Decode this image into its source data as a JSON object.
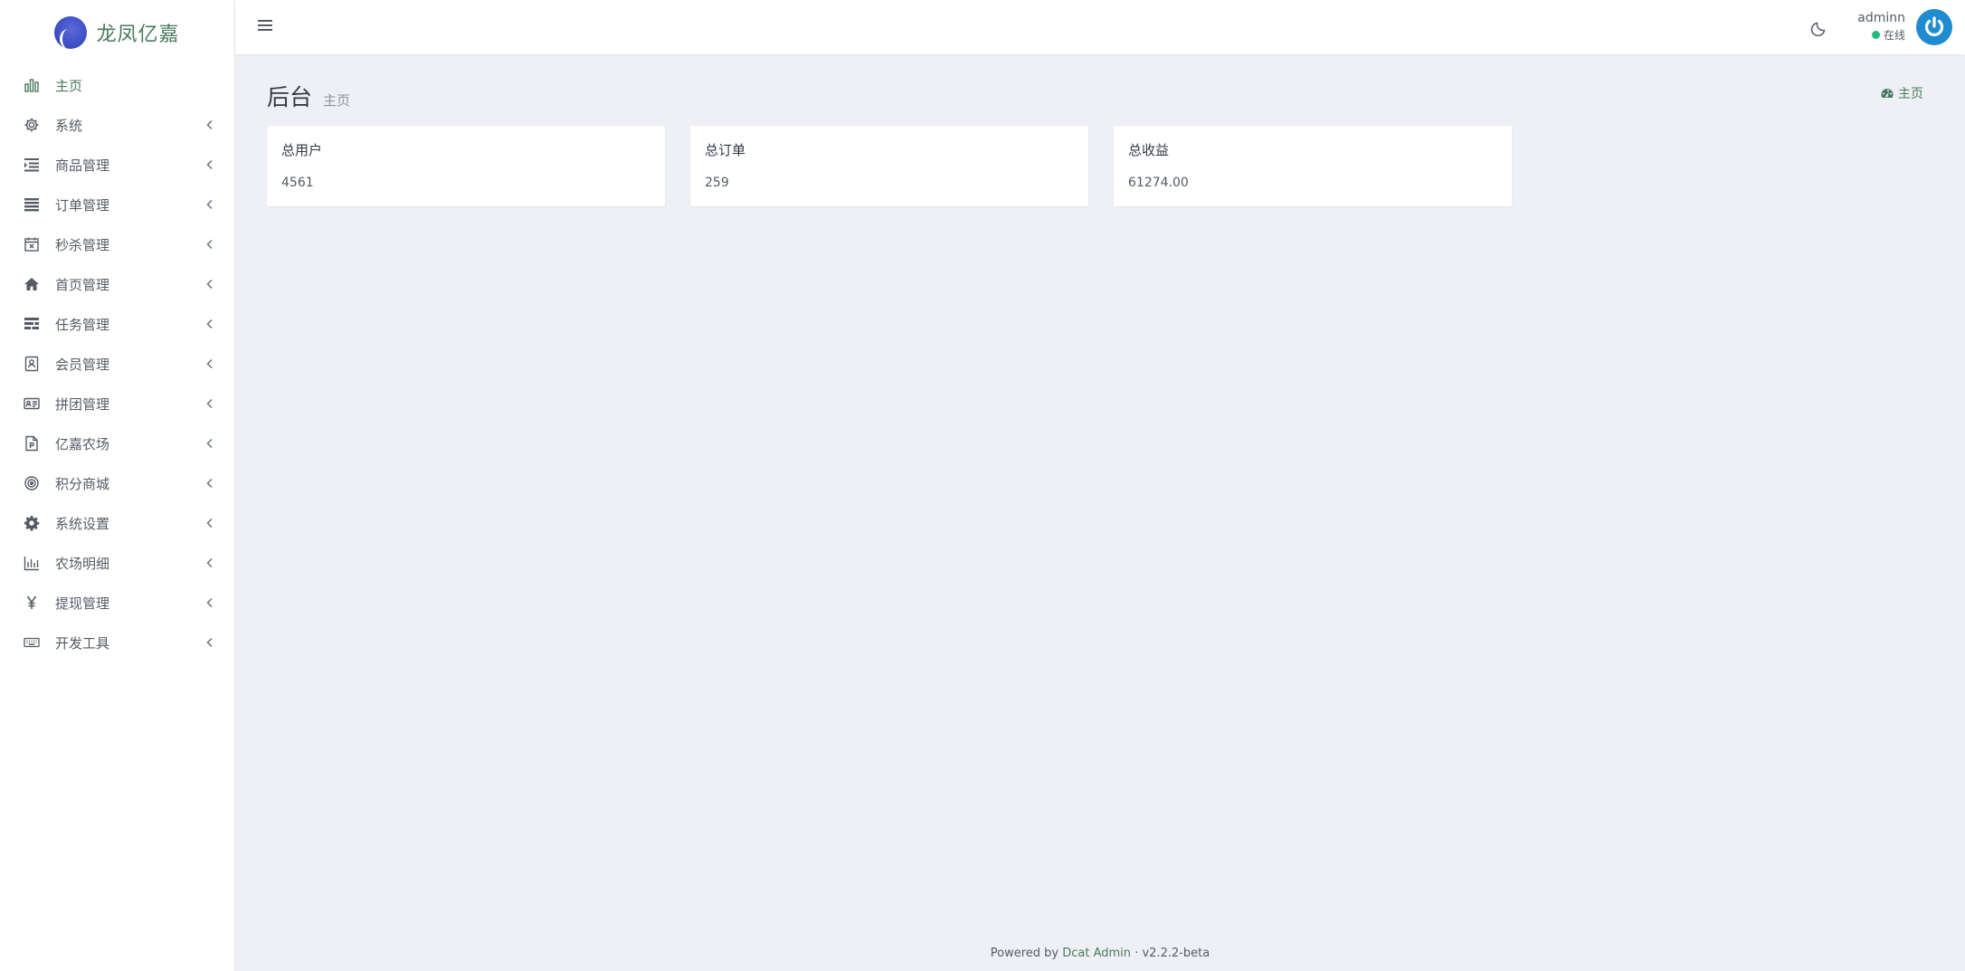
{
  "brand": {
    "title": "龙凤亿嘉",
    "logo_icon": "moon-logo"
  },
  "sidebar": {
    "items": [
      {
        "label": "主页",
        "icon": "bar-chart-icon",
        "active": true,
        "has_children": false
      },
      {
        "label": "系统",
        "icon": "gear-icon",
        "has_children": true
      },
      {
        "label": "商品管理",
        "icon": "indent-list-icon",
        "has_children": true
      },
      {
        "label": "订单管理",
        "icon": "list-icon",
        "has_children": true
      },
      {
        "label": "秒杀管理",
        "icon": "calendar-x-icon",
        "has_children": true
      },
      {
        "label": "首页管理",
        "icon": "home-icon",
        "has_children": true
      },
      {
        "label": "任务管理",
        "icon": "tasks-icon",
        "has_children": true
      },
      {
        "label": "会员管理",
        "icon": "member-card-icon",
        "has_children": true
      },
      {
        "label": "拼团管理",
        "icon": "id-card-icon",
        "has_children": true
      },
      {
        "label": "亿嘉农场",
        "icon": "file-p-icon",
        "has_children": true
      },
      {
        "label": "积分商城",
        "icon": "target-icon",
        "has_children": true
      },
      {
        "label": "系统设置",
        "icon": "cog-icon",
        "has_children": true
      },
      {
        "label": "农场明细",
        "icon": "column-chart-icon",
        "has_children": true
      },
      {
        "label": "提现管理",
        "icon": "yen-icon",
        "has_children": true
      },
      {
        "label": "开发工具",
        "icon": "keyboard-icon",
        "has_children": true
      }
    ]
  },
  "header": {
    "user": {
      "name": "adminn",
      "status": "在线"
    }
  },
  "content": {
    "title": "后台",
    "subtitle": "主页",
    "breadcrumb": "主页"
  },
  "cards": [
    {
      "title": "总用户",
      "value": "4561"
    },
    {
      "title": "总订单",
      "value": "259"
    },
    {
      "title": "总收益",
      "value": "61274.00"
    }
  ],
  "footer": {
    "powered_by": "Powered by",
    "link_text": "Dcat Admin",
    "separator": "·",
    "version": "v2.2.2-beta"
  },
  "colors": {
    "accent": "#4a7a5d",
    "background": "#eff0f5",
    "online": "#21b978",
    "avatar": "#1f8bd0"
  }
}
